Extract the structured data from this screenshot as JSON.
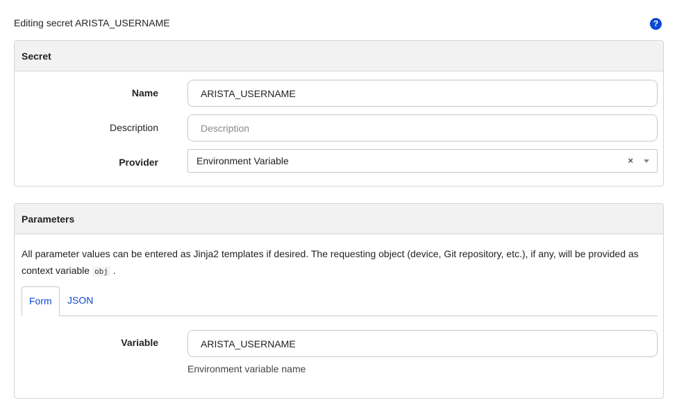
{
  "page": {
    "title": "Editing secret ARISTA_USERNAME",
    "help_icon": "question-circle-icon"
  },
  "secret_panel": {
    "heading": "Secret",
    "name_label": "Name",
    "name_value": "ARISTA_USERNAME",
    "description_label": "Description",
    "description_value": "",
    "description_placeholder": "Description",
    "provider_label": "Provider",
    "provider_value": "Environment Variable",
    "provider_clear": "×"
  },
  "parameters_panel": {
    "heading": "Parameters",
    "help_text_before": "All parameter values can be entered as Jinja2 templates if desired. The requesting object (device, Git repository, etc.), if any, will be provided as context variable ",
    "help_code": "obj",
    "help_text_after": ".",
    "tabs": [
      {
        "label": "Form",
        "active": true
      },
      {
        "label": "JSON",
        "active": false
      }
    ],
    "variable_label": "Variable",
    "variable_value": "ARISTA_USERNAME",
    "variable_help": "Environment variable name"
  },
  "colors": {
    "accent": "#0a48d6",
    "panel_heading_bg": "#f2f2f2",
    "border": "#d4d4d4"
  }
}
